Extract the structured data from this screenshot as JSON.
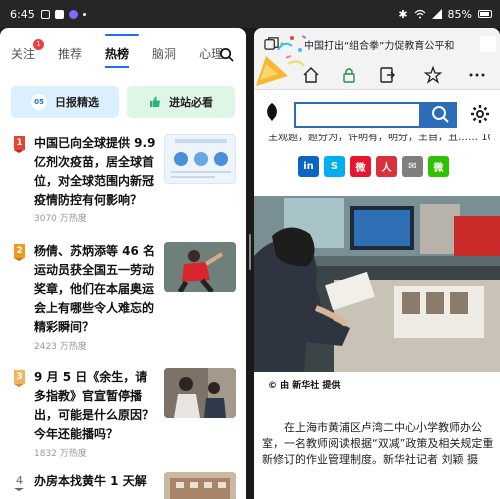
{
  "status_bar": {
    "time": "6:45",
    "battery": "85%"
  },
  "left_app": {
    "tabs": [
      {
        "label": "关注",
        "badge": "1"
      },
      {
        "label": "推荐"
      },
      {
        "label": "热榜",
        "active": true
      },
      {
        "label": "脑洞"
      },
      {
        "label": "心理"
      }
    ],
    "pills": [
      {
        "label": "日报精选",
        "number": "05"
      },
      {
        "label": "进站必看"
      }
    ],
    "news": [
      {
        "rank": "1",
        "title": "中国已向全球提供 9.9 亿剂次疫苗，居全球首位，对全球范围内新冠疫情防控有何影响？",
        "heat": "3070 万热度"
      },
      {
        "rank": "2",
        "title": "杨倩、苏炳添等 46 名运动员获全国五一劳动奖章，他们在本届奥运会上有哪些令人难忘的精彩瞬间？",
        "heat": "2423 万热度"
      },
      {
        "rank": "3",
        "title": "9 月 5 日《余生，请多指教》官宣暂停播出，可能是什么原因？今年还能播吗？",
        "heat": "1832 万热度"
      },
      {
        "rank": "4",
        "title": "办房本找黄牛 1 天解"
      }
    ]
  },
  "right_app": {
    "page_title": "中国打出“组合拳”力促教育公平和",
    "search_placeholder": "",
    "cut_text": "主观题，题分为，许明有，明分，王自，丑……    10 小时",
    "share_buttons": [
      "in",
      "S",
      "微",
      "人",
      "✉",
      "微"
    ],
    "photo_credit": "© 由 新华社 提供",
    "body": "在上海市黄浦区卢湾二中心小学教师办公室，一名教师阅读根据“双减”政策及相关规定重新修订的作业管理制度。新华社记者 刘颖 摄"
  },
  "colors": {
    "accent_blue": "#1e6cff",
    "rank1": "#e84235",
    "rank2": "#f39a1e",
    "rank3": "#f5b45a",
    "search_blue": "#2c6cb8"
  }
}
